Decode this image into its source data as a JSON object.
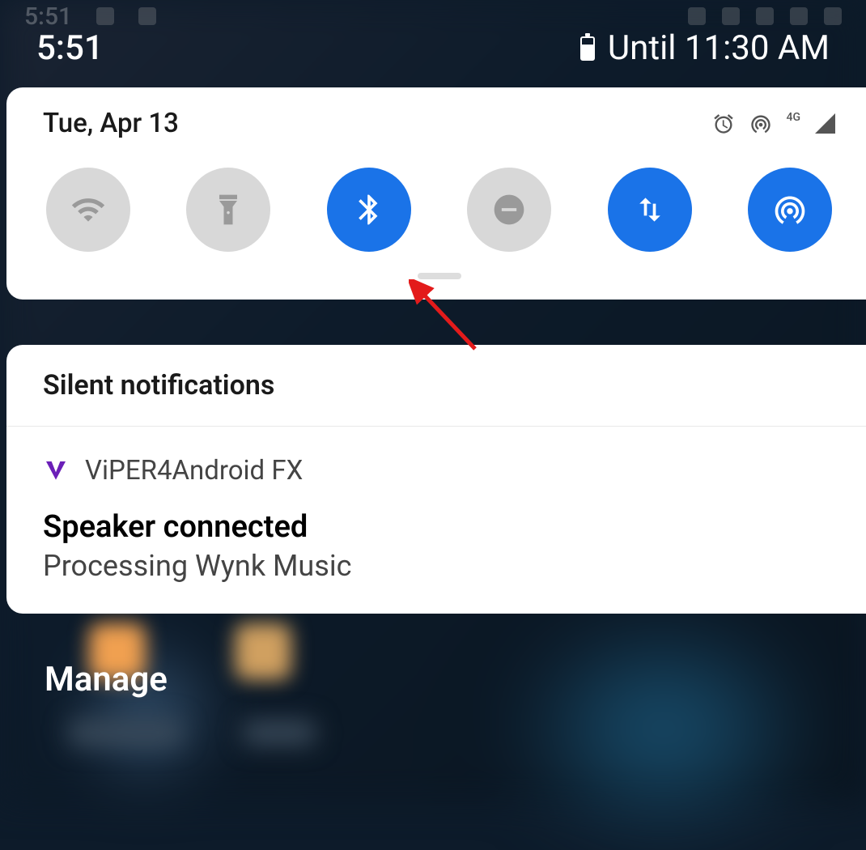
{
  "status_bar": {
    "time": "5:51",
    "battery_until_label": "Until 11:30 AM",
    "network_label": "4G"
  },
  "quick_settings": {
    "date": "Tue, Apr 13",
    "toggles": [
      {
        "name": "wifi",
        "active": false
      },
      {
        "name": "flashlight",
        "active": false
      },
      {
        "name": "bluetooth",
        "active": true
      },
      {
        "name": "do-not-disturb",
        "active": false
      },
      {
        "name": "mobile-data",
        "active": true
      },
      {
        "name": "hotspot",
        "active": true
      }
    ]
  },
  "notifications": {
    "section_label": "Silent notifications",
    "items": [
      {
        "app_name": "ViPER4Android FX",
        "title": "Speaker connected",
        "text": "Processing Wynk Music"
      }
    ]
  },
  "actions": {
    "manage_label": "Manage"
  },
  "colors": {
    "accent_on": "#1a73e8",
    "toggle_off": "#d8d8d8",
    "app_icon_purple": "#6b1fb8"
  }
}
